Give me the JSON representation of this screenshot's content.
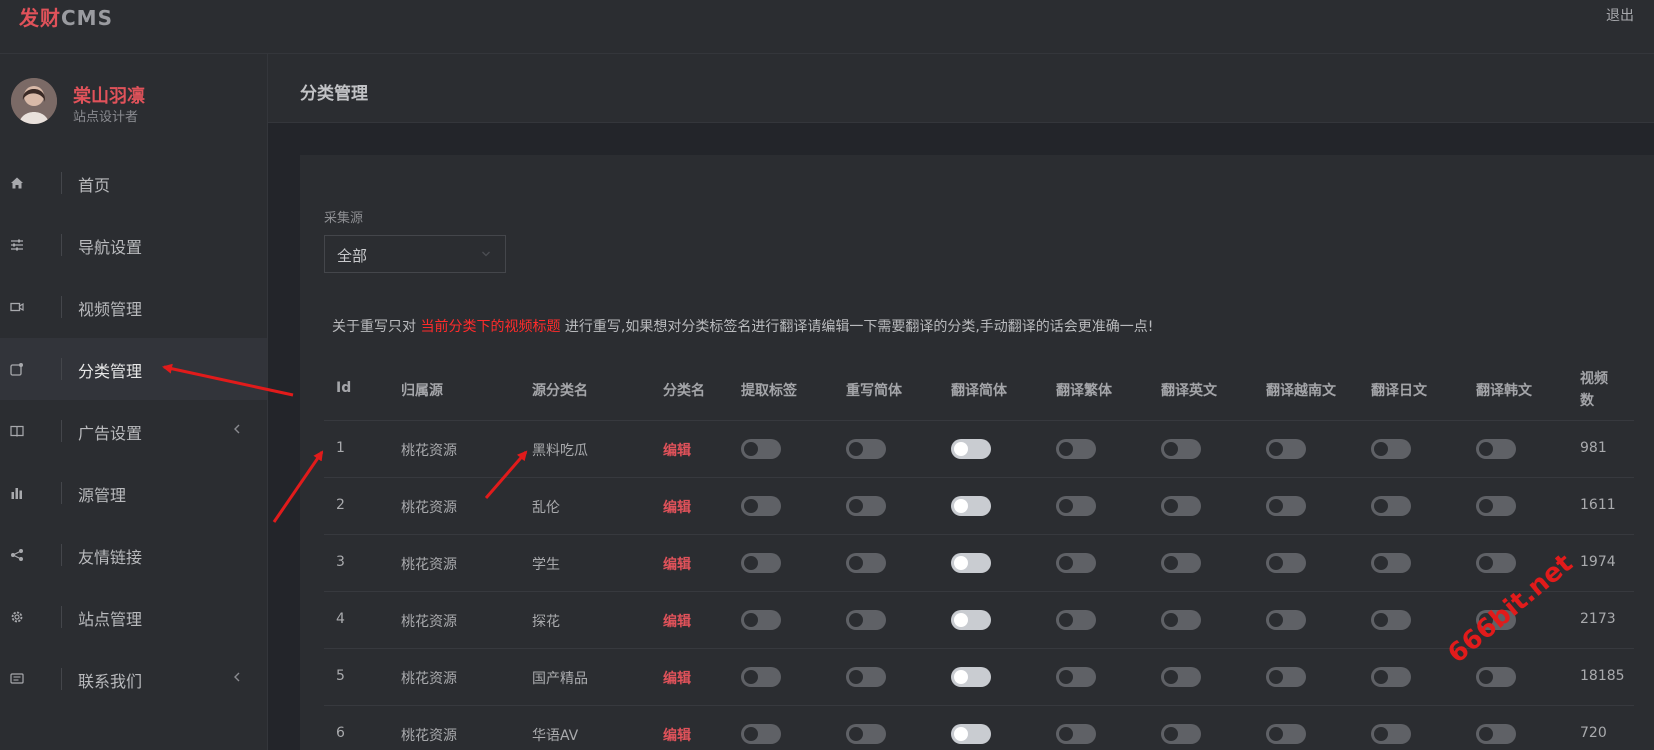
{
  "topbar": {
    "logo_part1": "发财",
    "logo_part2": "CMS",
    "logout_label": "退出"
  },
  "profile": {
    "name": "棠山羽凛",
    "role": "站点设计者"
  },
  "sidebar": {
    "items": [
      {
        "label": "首页",
        "icon": "home-icon",
        "has_chevron": false,
        "active": false
      },
      {
        "label": "导航设置",
        "icon": "sliders-icon",
        "has_chevron": false,
        "active": false
      },
      {
        "label": "视频管理",
        "icon": "video-icon",
        "has_chevron": false,
        "active": false
      },
      {
        "label": "分类管理",
        "icon": "category-icon",
        "has_chevron": false,
        "active": true
      },
      {
        "label": "广告设置",
        "icon": "book-icon",
        "has_chevron": true,
        "active": false
      },
      {
        "label": "源管理",
        "icon": "bar-chart-icon",
        "has_chevron": false,
        "active": false
      },
      {
        "label": "友情链接",
        "icon": "share-icon",
        "has_chevron": false,
        "active": false
      },
      {
        "label": "站点管理",
        "icon": "gear-icon",
        "has_chevron": false,
        "active": false
      },
      {
        "label": "联系我们",
        "icon": "message-icon",
        "has_chevron": true,
        "active": false
      }
    ]
  },
  "page": {
    "title": "分类管理"
  },
  "filter": {
    "label": "采集源",
    "selected": "全部"
  },
  "notice": {
    "before": "关于重写只对 ",
    "highlight": "当前分类下的视频标题",
    "after": " 进行重写,如果想对分类标签名进行翻译请编辑一下需要翻译的分类,手动翻译的话会更准确一点!"
  },
  "table": {
    "headers": [
      "Id",
      "归属源",
      "源分类名",
      "分类名",
      "提取标签",
      "重写简体",
      "翻译简体",
      "翻译繁体",
      "翻译英文",
      "翻译越南文",
      "翻译日文",
      "翻译韩文",
      "视频数"
    ],
    "rows": [
      {
        "id": "1",
        "source": "桃花资源",
        "src_cat": "黑料吃瓜",
        "action": "编辑",
        "toggles": [
          false,
          false,
          true,
          false,
          false,
          false,
          false,
          false
        ],
        "count": "981"
      },
      {
        "id": "2",
        "source": "桃花资源",
        "src_cat": "乱伦",
        "action": "编辑",
        "toggles": [
          false,
          false,
          true,
          false,
          false,
          false,
          false,
          false
        ],
        "count": "1611"
      },
      {
        "id": "3",
        "source": "桃花资源",
        "src_cat": "学生",
        "action": "编辑",
        "toggles": [
          false,
          false,
          true,
          false,
          false,
          false,
          false,
          false
        ],
        "count": "1974"
      },
      {
        "id": "4",
        "source": "桃花资源",
        "src_cat": "探花",
        "action": "编辑",
        "toggles": [
          false,
          false,
          true,
          false,
          false,
          false,
          false,
          false
        ],
        "count": "2173"
      },
      {
        "id": "5",
        "source": "桃花资源",
        "src_cat": "国产精品",
        "action": "编辑",
        "toggles": [
          false,
          false,
          true,
          false,
          false,
          false,
          false,
          false
        ],
        "count": "18185"
      },
      {
        "id": "6",
        "source": "桃花资源",
        "src_cat": "华语AV",
        "action": "编辑",
        "toggles": [
          false,
          false,
          true,
          false,
          false,
          false,
          false,
          false
        ],
        "count": "720"
      }
    ]
  },
  "watermark": "666bit.net",
  "colors": {
    "accent": "#e0525a",
    "highlight": "#ff2b2b",
    "annotation": "#e11b1b"
  }
}
